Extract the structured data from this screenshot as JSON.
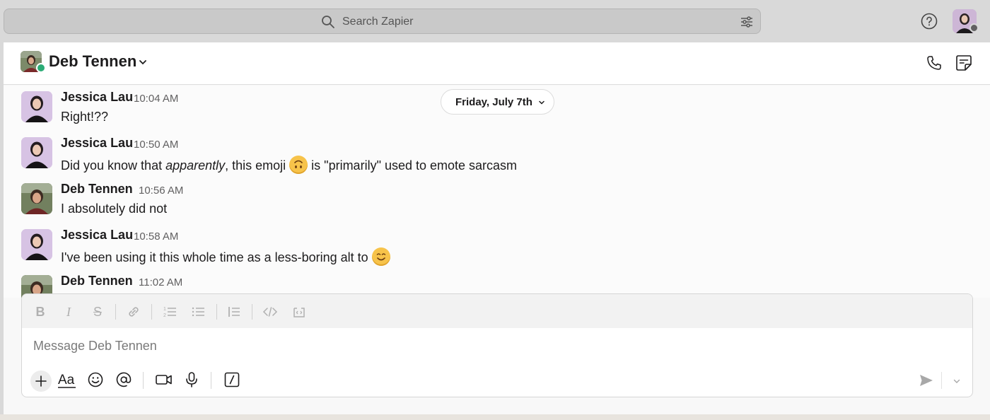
{
  "search": {
    "placeholder": "Search Zapier"
  },
  "channel": {
    "name": "Deb Tennen",
    "status": "online"
  },
  "date_divider": {
    "label": "Friday, July 7th"
  },
  "messages": [
    {
      "author": "Jessica Lau",
      "time": "10:04 AM",
      "text": "Right!??"
    },
    {
      "author": "Jessica Lau",
      "time": "10:50 AM",
      "text_parts": [
        "Did you know that ",
        "apparently",
        ", this emoji ",
        " is \"primarily\" used to emote sarcasm"
      ],
      "emoji": "upside-down-face"
    },
    {
      "author": "Deb Tennen",
      "time": "10:56 AM",
      "text": "I absolutely did not"
    },
    {
      "author": "Jessica Lau",
      "time": "10:58 AM",
      "text": "I've been using it this whole time as a less-boring alt to ",
      "emoji": "smiling-face"
    },
    {
      "author": "Deb Tennen",
      "time": "11:02 AM",
      "text": ""
    }
  ],
  "composer": {
    "placeholder": "Message Deb Tennen"
  },
  "colors": {
    "online": "#2bac76",
    "emoji": "#f7c34a",
    "topbar": "#d9d9d9"
  }
}
